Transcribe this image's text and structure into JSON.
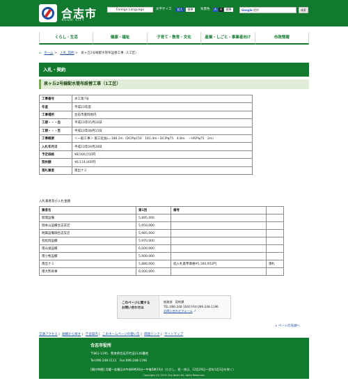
{
  "header": {
    "site_name": "合志市",
    "site_sub": "KOSHI CITY",
    "lang_button": "Foreign Language",
    "font_size_label": "文字サイズ",
    "font_enlarge": "拡大",
    "font_standard": "標準",
    "bg_color_label": "背景色",
    "bg_a1": "A",
    "bg_a2": "A",
    "bg_standard": "標準",
    "search_brand": "Google",
    "search_placeholder": "提供",
    "search_button": "検索"
  },
  "gnav": [
    "くらし・生活",
    "健康・福祉",
    "子育て・教育・文化",
    "産業・しごと・事業者向け",
    "市政情報"
  ],
  "breadcrumb": [
    "ホーム",
    ">",
    "入札_契約",
    ">",
    "泉ヶ丘2号線配水管布設替工事（1工区）"
  ],
  "page_title": "入札・契約",
  "subtitle": "泉ヶ丘2号線配水管布設替工事（1工区）",
  "info_rows": [
    {
      "label": "工事番号",
      "value": "水工第7号"
    },
    {
      "label": "年度",
      "value": "平成23年度"
    },
    {
      "label": "工事場所",
      "value": "合志市豊岡地内"
    },
    {
      "label": "工期・・・自",
      "value": "平成23年05月16日"
    },
    {
      "label": "工期・・・至",
      "value": "平成23年08月15日"
    },
    {
      "label": "工事概要",
      "value": "＜一般工事＞ 施工延長L=188.2m（DCIPφ150　181.4m・DCIPφ75　4.8m　・HIVPφ75　2m）"
    },
    {
      "label": "入札年月日",
      "value": "平成23年04月28日"
    },
    {
      "label": "予定価格",
      "value": "¥8,500,550円"
    },
    {
      "label": "契約額",
      "value": "¥6,174,000円"
    },
    {
      "label": "落札業者",
      "value": "南出ナミ"
    }
  ],
  "bid_caption": "入札業者及び入札金額",
  "bid_header": [
    "業者名",
    "第1回",
    "備考",
    ""
  ],
  "bid_rows": [
    [
      "新開設備",
      "5,895,000",
      "",
      ""
    ],
    [
      "岡本山設備合志支店",
      "5,950,000",
      "",
      ""
    ],
    [
      "明興設備御合志支店",
      "5,985,000",
      "",
      ""
    ],
    [
      "有松岡設備",
      "5,970,000",
      "",
      ""
    ],
    [
      "南山涌設備",
      "6,000,000",
      "",
      ""
    ],
    [
      "南小牧設備",
      "5,900,000",
      "",
      ""
    ],
    [
      "南出ナミ",
      "5,880,000",
      "低入札基準価格¥5,160,952円",
      "落札"
    ],
    [
      "南大熊商事",
      "6,000,000",
      "",
      ""
    ]
  ],
  "contact": {
    "heading_1": "このページに関する",
    "heading_2": "お問い合わせは",
    "dept": "総務部　契約課",
    "tel": "TEL:096-248-1040 FAX:096-248-1196",
    "form_link": "お問い合わせフォーム"
  },
  "pagetop": "ページの先頭へ",
  "footer_nav": [
    "交通アクセス",
    "|",
    "組織から探す",
    "|",
    "庁舎案内",
    "|",
    "このホームページの使い方",
    "|",
    "関連リンク",
    "|",
    "サイトマップ"
  ],
  "footer": {
    "name": "合志市役所",
    "address": "〒861-1195　熊本県合志市竹迫2140番地",
    "tel": "Tel:096-248-1111　Fax:096-248-1196",
    "hours": "[開庁時間] 月曜～金曜日の午前8時30分～午後5時15分（ただし、祝・休日、12月29日～翌年1月3日を除く）",
    "copyright": "Copyright (C) 2019 City Koshi All rights Reserved."
  }
}
